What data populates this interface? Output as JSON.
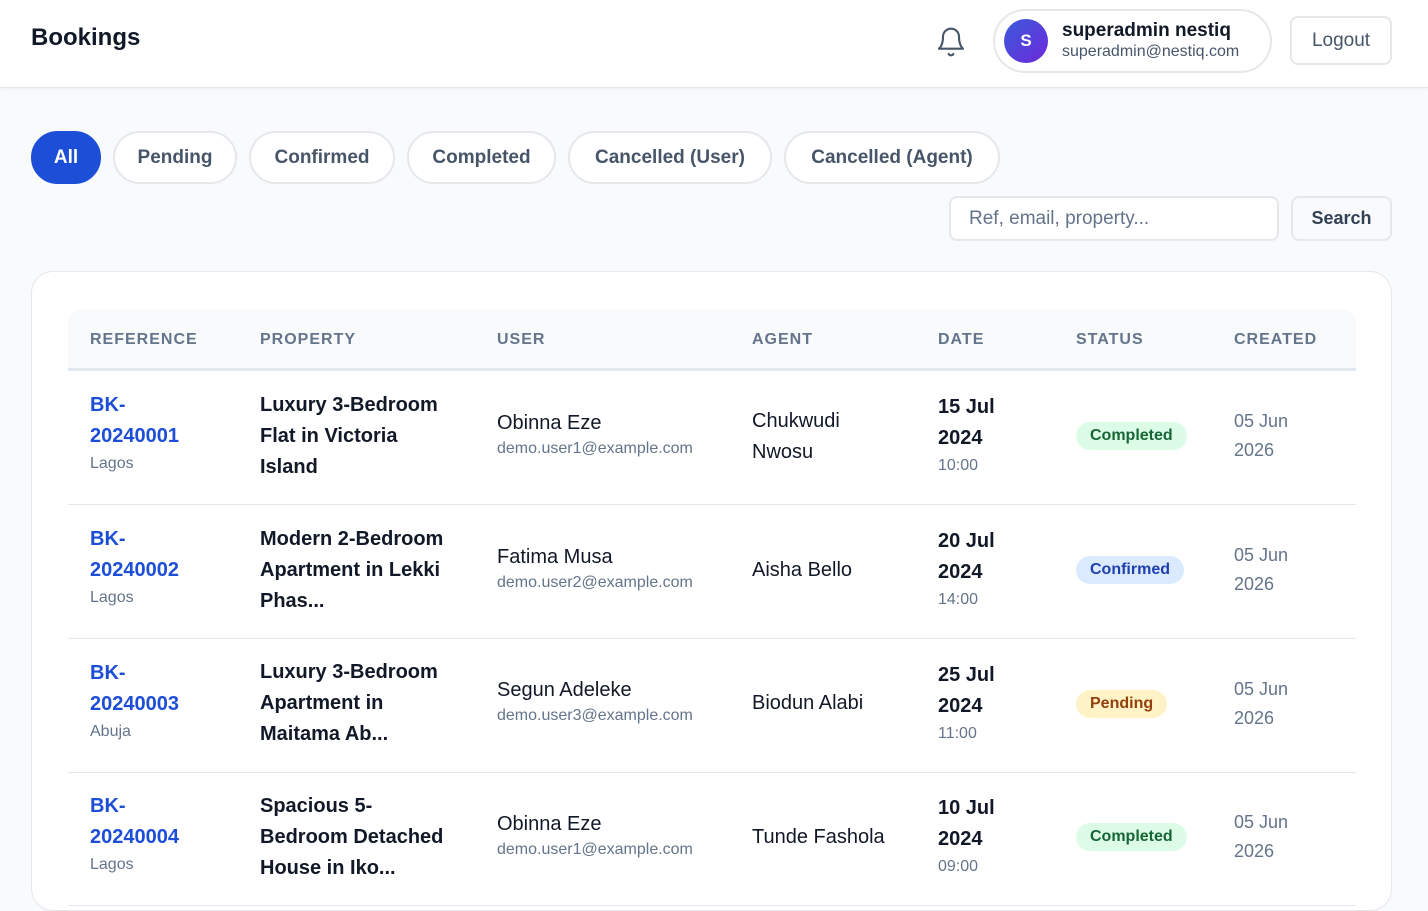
{
  "header": {
    "title": "Bookings",
    "user": {
      "initial": "S",
      "name": "superadmin nestiq",
      "email": "superadmin@nestiq.com"
    },
    "logout_label": "Logout"
  },
  "filters": [
    "All",
    "Pending",
    "Confirmed",
    "Completed",
    "Cancelled (User)",
    "Cancelled (Agent)"
  ],
  "active_filter": "All",
  "search": {
    "placeholder": "Ref, email, property...",
    "value": "",
    "button_label": "Search"
  },
  "table": {
    "columns": [
      "REFERENCE",
      "PROPERTY",
      "USER",
      "AGENT",
      "DATE",
      "STATUS",
      "CREATED"
    ],
    "rows": [
      {
        "ref_line1": "BK-",
        "ref_line2": "20240001",
        "city": "Lagos",
        "property": "Luxury 3-Bedroom Flat in Victoria Island",
        "user_name": "Obinna Eze",
        "user_email": "demo.user1@example.com",
        "agent": "Chukwudi Nwosu",
        "date_line1": "15 Jul",
        "date_line2": "2024",
        "time": "10:00",
        "status": "Completed",
        "created_line1": "05 Jun",
        "created_line2": "2026"
      },
      {
        "ref_line1": "BK-",
        "ref_line2": "20240002",
        "city": "Lagos",
        "property": "Modern 2-Bedroom Apartment in Lekki Phas...",
        "user_name": "Fatima Musa",
        "user_email": "demo.user2@example.com",
        "agent": "Aisha Bello",
        "date_line1": "20 Jul",
        "date_line2": "2024",
        "time": "14:00",
        "status": "Confirmed",
        "created_line1": "05 Jun",
        "created_line2": "2026"
      },
      {
        "ref_line1": "BK-",
        "ref_line2": "20240003",
        "city": "Abuja",
        "property": "Luxury 3-Bedroom Apartment in Maitama Ab...",
        "user_name": "Segun Adeleke",
        "user_email": "demo.user3@example.com",
        "agent": "Biodun Alabi",
        "date_line1": "25 Jul",
        "date_line2": "2024",
        "time": "11:00",
        "status": "Pending",
        "created_line1": "05 Jun",
        "created_line2": "2026"
      },
      {
        "ref_line1": "BK-",
        "ref_line2": "20240004",
        "city": "Lagos",
        "property": "Spacious 5-Bedroom Detached House in Iko...",
        "user_name": "Obinna Eze",
        "user_email": "demo.user1@example.com",
        "agent": "Tunde Fashola",
        "date_line1": "10 Jul",
        "date_line2": "2024",
        "time": "09:00",
        "status": "Completed",
        "created_line1": "05 Jun",
        "created_line2": "2026"
      }
    ]
  },
  "icons": {
    "notifications": "bell-icon"
  },
  "colors": {
    "accent": "#1d4ed8",
    "completed_bg": "#dcfce7",
    "completed_text": "#166534",
    "confirmed_bg": "#dbeafe",
    "confirmed_text": "#1e40af",
    "pending_bg": "#fef3c7",
    "pending_text": "#92400e"
  }
}
